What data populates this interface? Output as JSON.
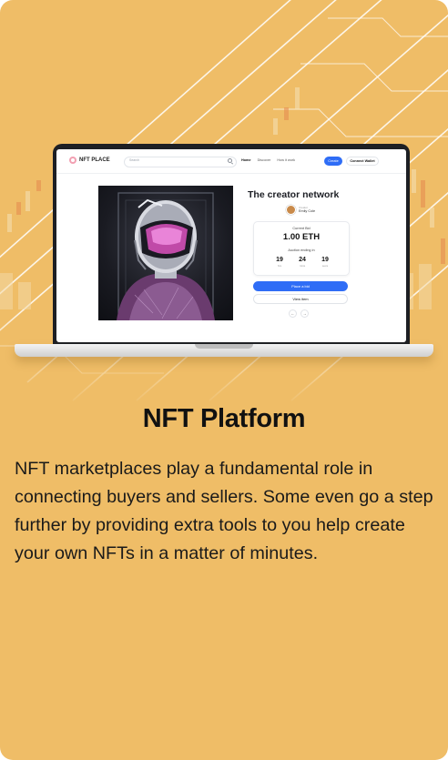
{
  "screen": {
    "logo_text": "NFT PLACE",
    "search_placeholder": "Search",
    "nav_links": [
      "Home",
      "Discover",
      "How it work"
    ],
    "create_button": "Create",
    "wallet_button": "Connect Wallet",
    "artwork_title": "The creator network",
    "creator_label": "Creator",
    "creator_name": "Emily Cole",
    "current_bid_label": "Current Bid",
    "current_bid_value": "1.00 ETH",
    "auction_label": "Auction ending in",
    "timer": [
      {
        "value": "19",
        "unit": "hrs"
      },
      {
        "value": "24",
        "unit": "mins"
      },
      {
        "value": "19",
        "unit": "secs"
      }
    ],
    "place_bid_button": "Place a bid",
    "view_item_button": "View item",
    "pager_prev": "←",
    "pager_next": "→"
  },
  "card": {
    "title": "NFT Platform",
    "description": "NFT marketplaces play a fundamental role in connecting buyers and sellers. Some even go a step further by providing extra tools to you help create your own NFTs in a matter of minutes."
  },
  "colors": {
    "card_background": "#efbd67",
    "accent_blue": "#2f6df6",
    "heading_text": "#111111"
  }
}
